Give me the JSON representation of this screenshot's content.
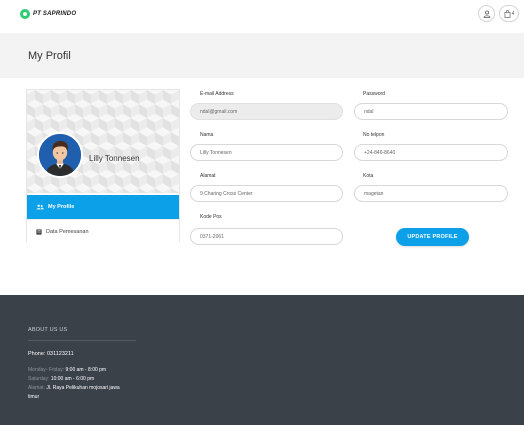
{
  "brand": {
    "name": "PT SAPRINDO",
    "accent": "#2ecc71"
  },
  "header": {
    "cart_count": "4",
    "user_icon": "user-icon",
    "cart_icon": "shopping-bag-icon"
  },
  "page": {
    "title": "My Profil"
  },
  "profile": {
    "name": "Lilly Tonnesen"
  },
  "nav": {
    "items": [
      {
        "label": "My Profile",
        "icon": "users-icon",
        "active": true
      },
      {
        "label": "Data Pemesanan",
        "icon": "file-icon",
        "active": false
      }
    ]
  },
  "form": {
    "email": {
      "label": "E-mail Address",
      "value": "ndal@gmail.com"
    },
    "password": {
      "label": "Password",
      "value": "ndal"
    },
    "name": {
      "label": "Nama",
      "value": "Lilly Tonnesen"
    },
    "phone": {
      "label": "No telpon",
      "value": "+24-846-8640"
    },
    "address": {
      "label": "Alamat",
      "value": "9 Charing Cross Center"
    },
    "city": {
      "label": "Kota",
      "value": "magetan"
    },
    "postal": {
      "label": "Kode Pos",
      "value": "0371-2061"
    },
    "submit_label": "UPDATE PROFILE"
  },
  "footer": {
    "about_title": "ABOUT US US",
    "phone": "Phone: 031123211",
    "hours_weekday_label": "Monday- Friday:",
    "hours_weekday_value": "9:00 am - 8:00 pm",
    "hours_saturday_label": "Saturday:",
    "hours_saturday_value": "10:00 am - 6:00 pm",
    "address_label": "Alamat:",
    "address_value": "Jl. Raya Pelikuhan mojosari jawa",
    "address_value_2": "timur"
  },
  "colors": {
    "primary": "#0ba0e8",
    "footer_bg": "#3a4149",
    "title_band": "#f3f3f3"
  }
}
